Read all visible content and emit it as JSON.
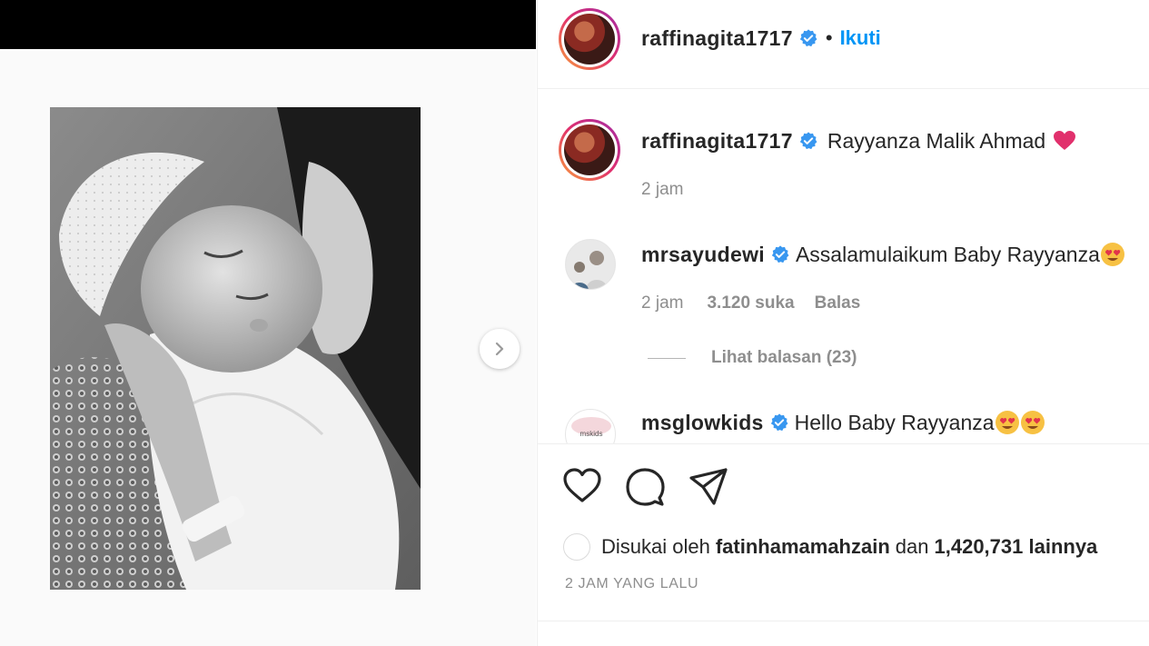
{
  "post": {
    "username": "raffinagita1717",
    "follow_label": "Ikuti",
    "separator": "•",
    "caption": "Rayyanza Malik Ahmad",
    "caption_time": "2 jam"
  },
  "comments": [
    {
      "username": "mrsayudewi",
      "text": "Assalamulaikum Baby Rayyanza",
      "time": "2 jam",
      "likes": "3.120 suka",
      "reply_label": "Balas",
      "view_replies": "Lihat balasan (23)"
    },
    {
      "username": "msglowkids",
      "text": "Hello Baby Rayyanza",
      "avatar_text": "mskids"
    }
  ],
  "likes_line": {
    "prefix": "Disukai oleh",
    "user": "fatinhamamahzain",
    "middle": "dan",
    "count": "1,420,731 lainnya"
  },
  "time_ago": "2 JAM YANG LALU",
  "colors": {
    "link_blue": "#0095f6",
    "verified_blue": "#3897f0",
    "heart_pink": "#e1306c",
    "muted_gray": "#8e8e8e"
  },
  "icons": [
    "verified-icon",
    "heart-emoji",
    "smiling-face-heart-eyes-emoji",
    "like-heart-icon",
    "comment-icon",
    "share-icon",
    "chevron-right-icon"
  ]
}
